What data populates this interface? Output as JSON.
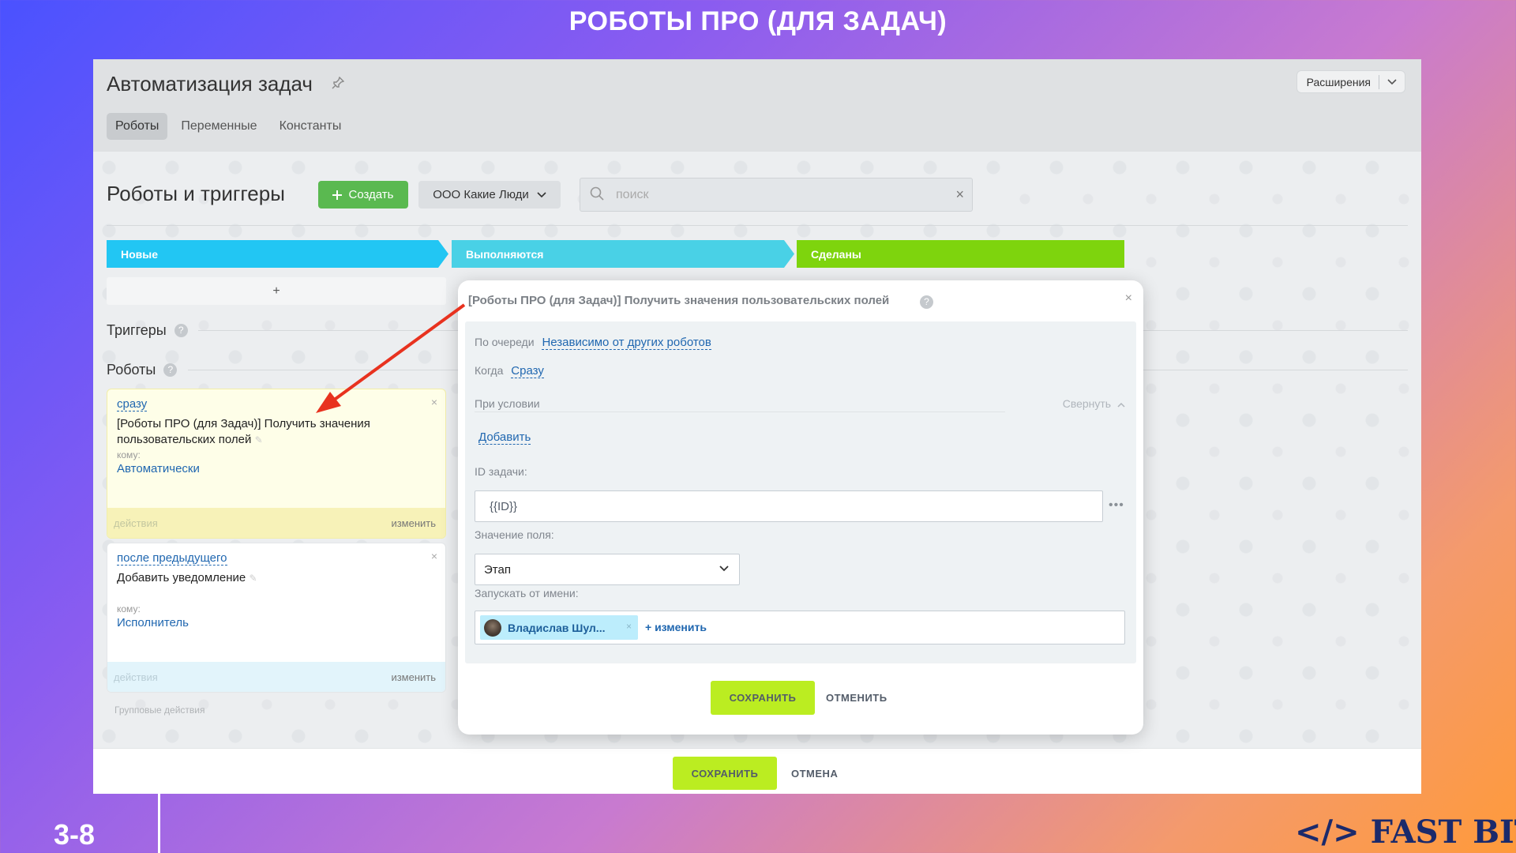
{
  "slide": {
    "title": "РОБОТЫ ПРО (ДЛЯ ЗАДАЧ)",
    "number": "3-8",
    "brand": "</> FAST BIT"
  },
  "header": {
    "title": "Автоматизация задач",
    "extensions_label": "Расширения",
    "tabs": [
      {
        "label": "Роботы"
      },
      {
        "label": "Переменные"
      },
      {
        "label": "Константы"
      }
    ]
  },
  "toolbar": {
    "section_title": "Роботы и триггеры",
    "create_label": "Создать",
    "company_label": "ООО Какие Люди",
    "search_placeholder": "поиск"
  },
  "stages": [
    {
      "label": "Новые",
      "color": "#22c6f3"
    },
    {
      "label": "Выполняются",
      "color": "#49d1e6"
    },
    {
      "label": "Сделаны",
      "color": "#7ed40d"
    }
  ],
  "column": {
    "add_label": "+",
    "triggers_label": "Триггеры",
    "robots_label": "Роботы",
    "group_actions": "Групповые действия",
    "cards": [
      {
        "trigger": "сразу",
        "text": "[Роботы ПРО (для Задач)] Получить значения пользовательских полей",
        "to_label": "кому:",
        "to_value": "Автоматически",
        "actions": "действия",
        "edit": "изменить"
      },
      {
        "trigger": "после предыдущего",
        "text": "Добавить уведомление",
        "to_label": "кому:",
        "to_value": "Исполнитель",
        "actions": "действия",
        "edit": "изменить"
      }
    ]
  },
  "dialog": {
    "title": "[Роботы ПРО (для Задач)] Получить значения пользовательских полей",
    "queue_label": "По очереди",
    "queue_value": "Независимо от других роботов",
    "when_label": "Когда",
    "when_value": "Сразу",
    "condition_label": "При условии",
    "collapse_label": "Свернуть",
    "add_label": "Добавить",
    "task_id_label": "ID задачи:",
    "task_id_value": "{{ID}}",
    "field_value_label": "Значение поля:",
    "field_value": "Этап",
    "run_as_label": "Запускать от имени:",
    "user_name": "Владислав Шул...",
    "change_label": "+ изменить",
    "save_label": "СОХРАНИТЬ",
    "cancel_label": "ОТМЕНИТЬ"
  },
  "footer": {
    "save_label": "СОХРАНИТЬ",
    "cancel_label": "ОТМЕНА"
  },
  "colors": {
    "accent_save": "#bbed21",
    "create_btn": "#5ab950",
    "link": "#2067b0",
    "arrow": "#e8321f"
  }
}
